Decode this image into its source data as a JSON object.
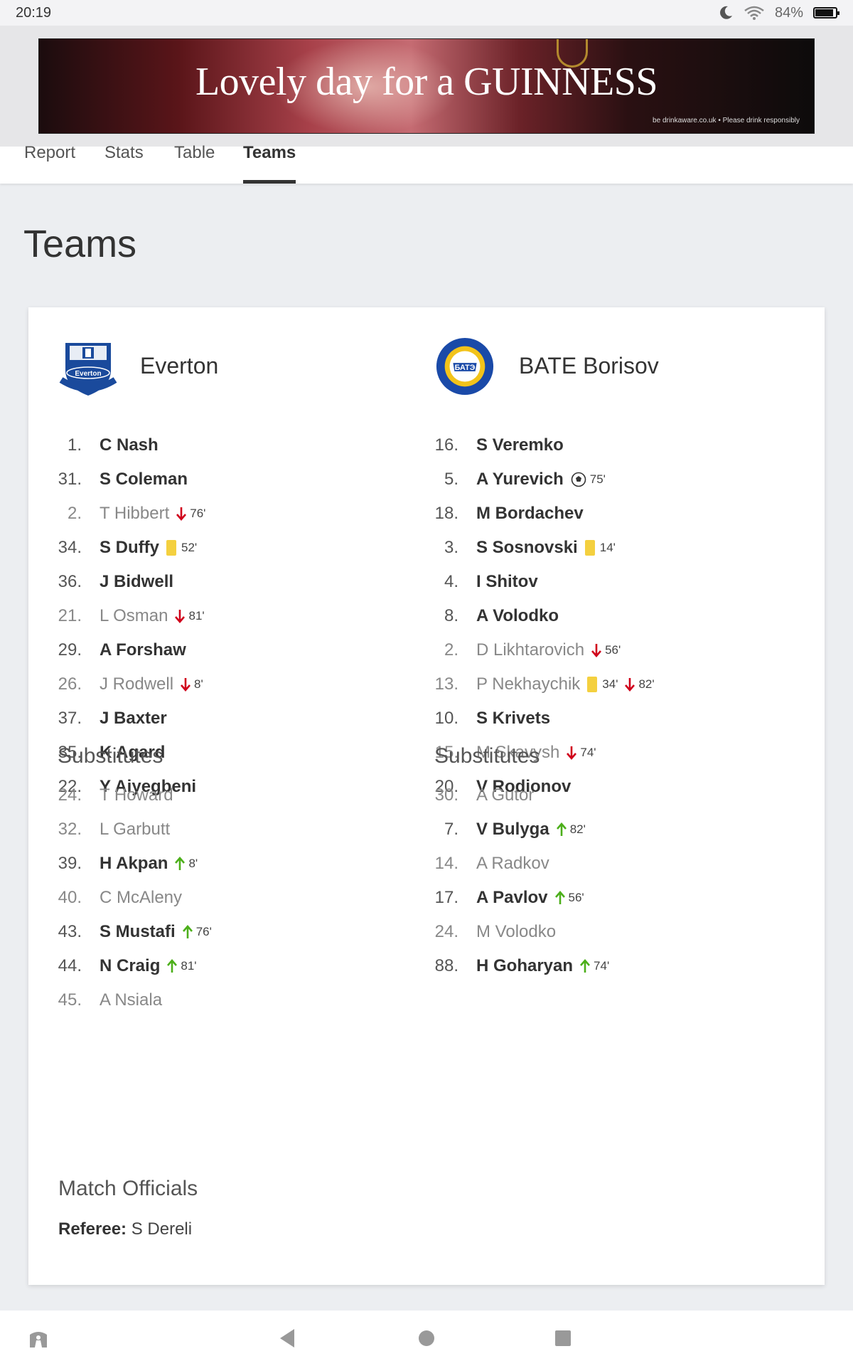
{
  "status": {
    "time": "20:19",
    "battery": "84%"
  },
  "ad": {
    "headline": "Lovely day for a GUINNESS",
    "small_print": "be drinkaware.co.uk • Please drink responsibly"
  },
  "tabs": [
    {
      "label": "Report",
      "active": false
    },
    {
      "label": "Stats",
      "active": false
    },
    {
      "label": "Table",
      "active": false
    },
    {
      "label": "Teams",
      "active": true
    }
  ],
  "page_title": "Teams",
  "home": {
    "name": "Everton",
    "crest_icon": "everton-crest-icon",
    "lineup": [
      {
        "num": "1.",
        "name": "C Nash",
        "starter_bold": true,
        "events": []
      },
      {
        "num": "31.",
        "name": "S Coleman",
        "starter_bold": true,
        "events": []
      },
      {
        "num": "2.",
        "name": "T Hibbert",
        "starter_bold": false,
        "events": [
          {
            "type": "sub-off",
            "minute": "76'"
          }
        ]
      },
      {
        "num": "34.",
        "name": "S Duffy",
        "starter_bold": true,
        "events": [
          {
            "type": "yellow",
            "minute": "52'"
          }
        ]
      },
      {
        "num": "36.",
        "name": "J Bidwell",
        "starter_bold": true,
        "events": []
      },
      {
        "num": "21.",
        "name": "L Osman",
        "starter_bold": false,
        "events": [
          {
            "type": "sub-off",
            "minute": "81'"
          }
        ]
      },
      {
        "num": "29.",
        "name": "A Forshaw",
        "starter_bold": true,
        "events": []
      },
      {
        "num": "26.",
        "name": "J Rodwell",
        "starter_bold": false,
        "events": [
          {
            "type": "sub-off",
            "minute": "8'"
          }
        ]
      },
      {
        "num": "37.",
        "name": "J Baxter",
        "starter_bold": true,
        "events": []
      },
      {
        "num": "35.",
        "name": "K Agard",
        "starter_bold": true,
        "events": []
      },
      {
        "num": "22.",
        "name": "Y Aiyegbeni",
        "starter_bold": true,
        "events": []
      }
    ],
    "subs_title": "Substitutes",
    "subs": [
      {
        "num": "24.",
        "name": "T Howard",
        "starter_bold": false,
        "events": []
      },
      {
        "num": "32.",
        "name": "L Garbutt",
        "starter_bold": false,
        "events": []
      },
      {
        "num": "39.",
        "name": "H Akpan",
        "starter_bold": true,
        "events": [
          {
            "type": "sub-on",
            "minute": "8'"
          }
        ]
      },
      {
        "num": "40.",
        "name": "C McAleny",
        "starter_bold": false,
        "events": []
      },
      {
        "num": "43.",
        "name": "S Mustafi",
        "starter_bold": true,
        "events": [
          {
            "type": "sub-on",
            "minute": "76'"
          }
        ]
      },
      {
        "num": "44.",
        "name": "N Craig",
        "starter_bold": true,
        "events": [
          {
            "type": "sub-on",
            "minute": "81'"
          }
        ]
      },
      {
        "num": "45.",
        "name": "A Nsiala",
        "starter_bold": false,
        "events": []
      }
    ]
  },
  "away": {
    "name": "BATE Borisov",
    "crest_icon": "bate-crest-icon",
    "lineup": [
      {
        "num": "16.",
        "name": "S Veremko",
        "starter_bold": true,
        "events": []
      },
      {
        "num": "5.",
        "name": "A Yurevich",
        "starter_bold": true,
        "events": [
          {
            "type": "goal",
            "minute": "75'"
          }
        ]
      },
      {
        "num": "18.",
        "name": "M Bordachev",
        "starter_bold": true,
        "events": []
      },
      {
        "num": "3.",
        "name": "S Sosnovski",
        "starter_bold": true,
        "events": [
          {
            "type": "yellow",
            "minute": "14'"
          }
        ]
      },
      {
        "num": "4.",
        "name": "I Shitov",
        "starter_bold": true,
        "events": []
      },
      {
        "num": "8.",
        "name": "A Volodko",
        "starter_bold": true,
        "events": []
      },
      {
        "num": "2.",
        "name": "D Likhtarovich",
        "starter_bold": false,
        "events": [
          {
            "type": "sub-off",
            "minute": "56'"
          }
        ]
      },
      {
        "num": "13.",
        "name": "P Nekhaychik",
        "starter_bold": false,
        "events": [
          {
            "type": "yellow",
            "minute": "34'"
          },
          {
            "type": "sub-off",
            "minute": "82'"
          }
        ]
      },
      {
        "num": "10.",
        "name": "S Krivets",
        "starter_bold": true,
        "events": []
      },
      {
        "num": "15.",
        "name": "M Skavysh",
        "starter_bold": false,
        "events": [
          {
            "type": "sub-off",
            "minute": "74'"
          }
        ]
      },
      {
        "num": "20.",
        "name": "V Rodionov",
        "starter_bold": true,
        "events": []
      }
    ],
    "subs_title": "Substitutes",
    "subs": [
      {
        "num": "30.",
        "name": "A Gutor",
        "starter_bold": false,
        "events": []
      },
      {
        "num": "7.",
        "name": "V Bulyga",
        "starter_bold": true,
        "events": [
          {
            "type": "sub-on",
            "minute": "82'"
          }
        ]
      },
      {
        "num": "14.",
        "name": "A Radkov",
        "starter_bold": false,
        "events": []
      },
      {
        "num": "17.",
        "name": "A Pavlov",
        "starter_bold": true,
        "events": [
          {
            "type": "sub-on",
            "minute": "56'"
          }
        ]
      },
      {
        "num": "24.",
        "name": "M Volodko",
        "starter_bold": false,
        "events": []
      },
      {
        "num": "88.",
        "name": "H Goharyan",
        "starter_bold": true,
        "events": [
          {
            "type": "sub-on",
            "minute": "74'"
          }
        ]
      }
    ]
  },
  "officials": {
    "title": "Match Officials",
    "referee_label": "Referee:",
    "referee_name": "S Dereli"
  },
  "colors": {
    "sub_off": "#d0021b",
    "sub_on": "#4caf1a",
    "yellow_card": "#f4d03f",
    "text": "#333333"
  }
}
